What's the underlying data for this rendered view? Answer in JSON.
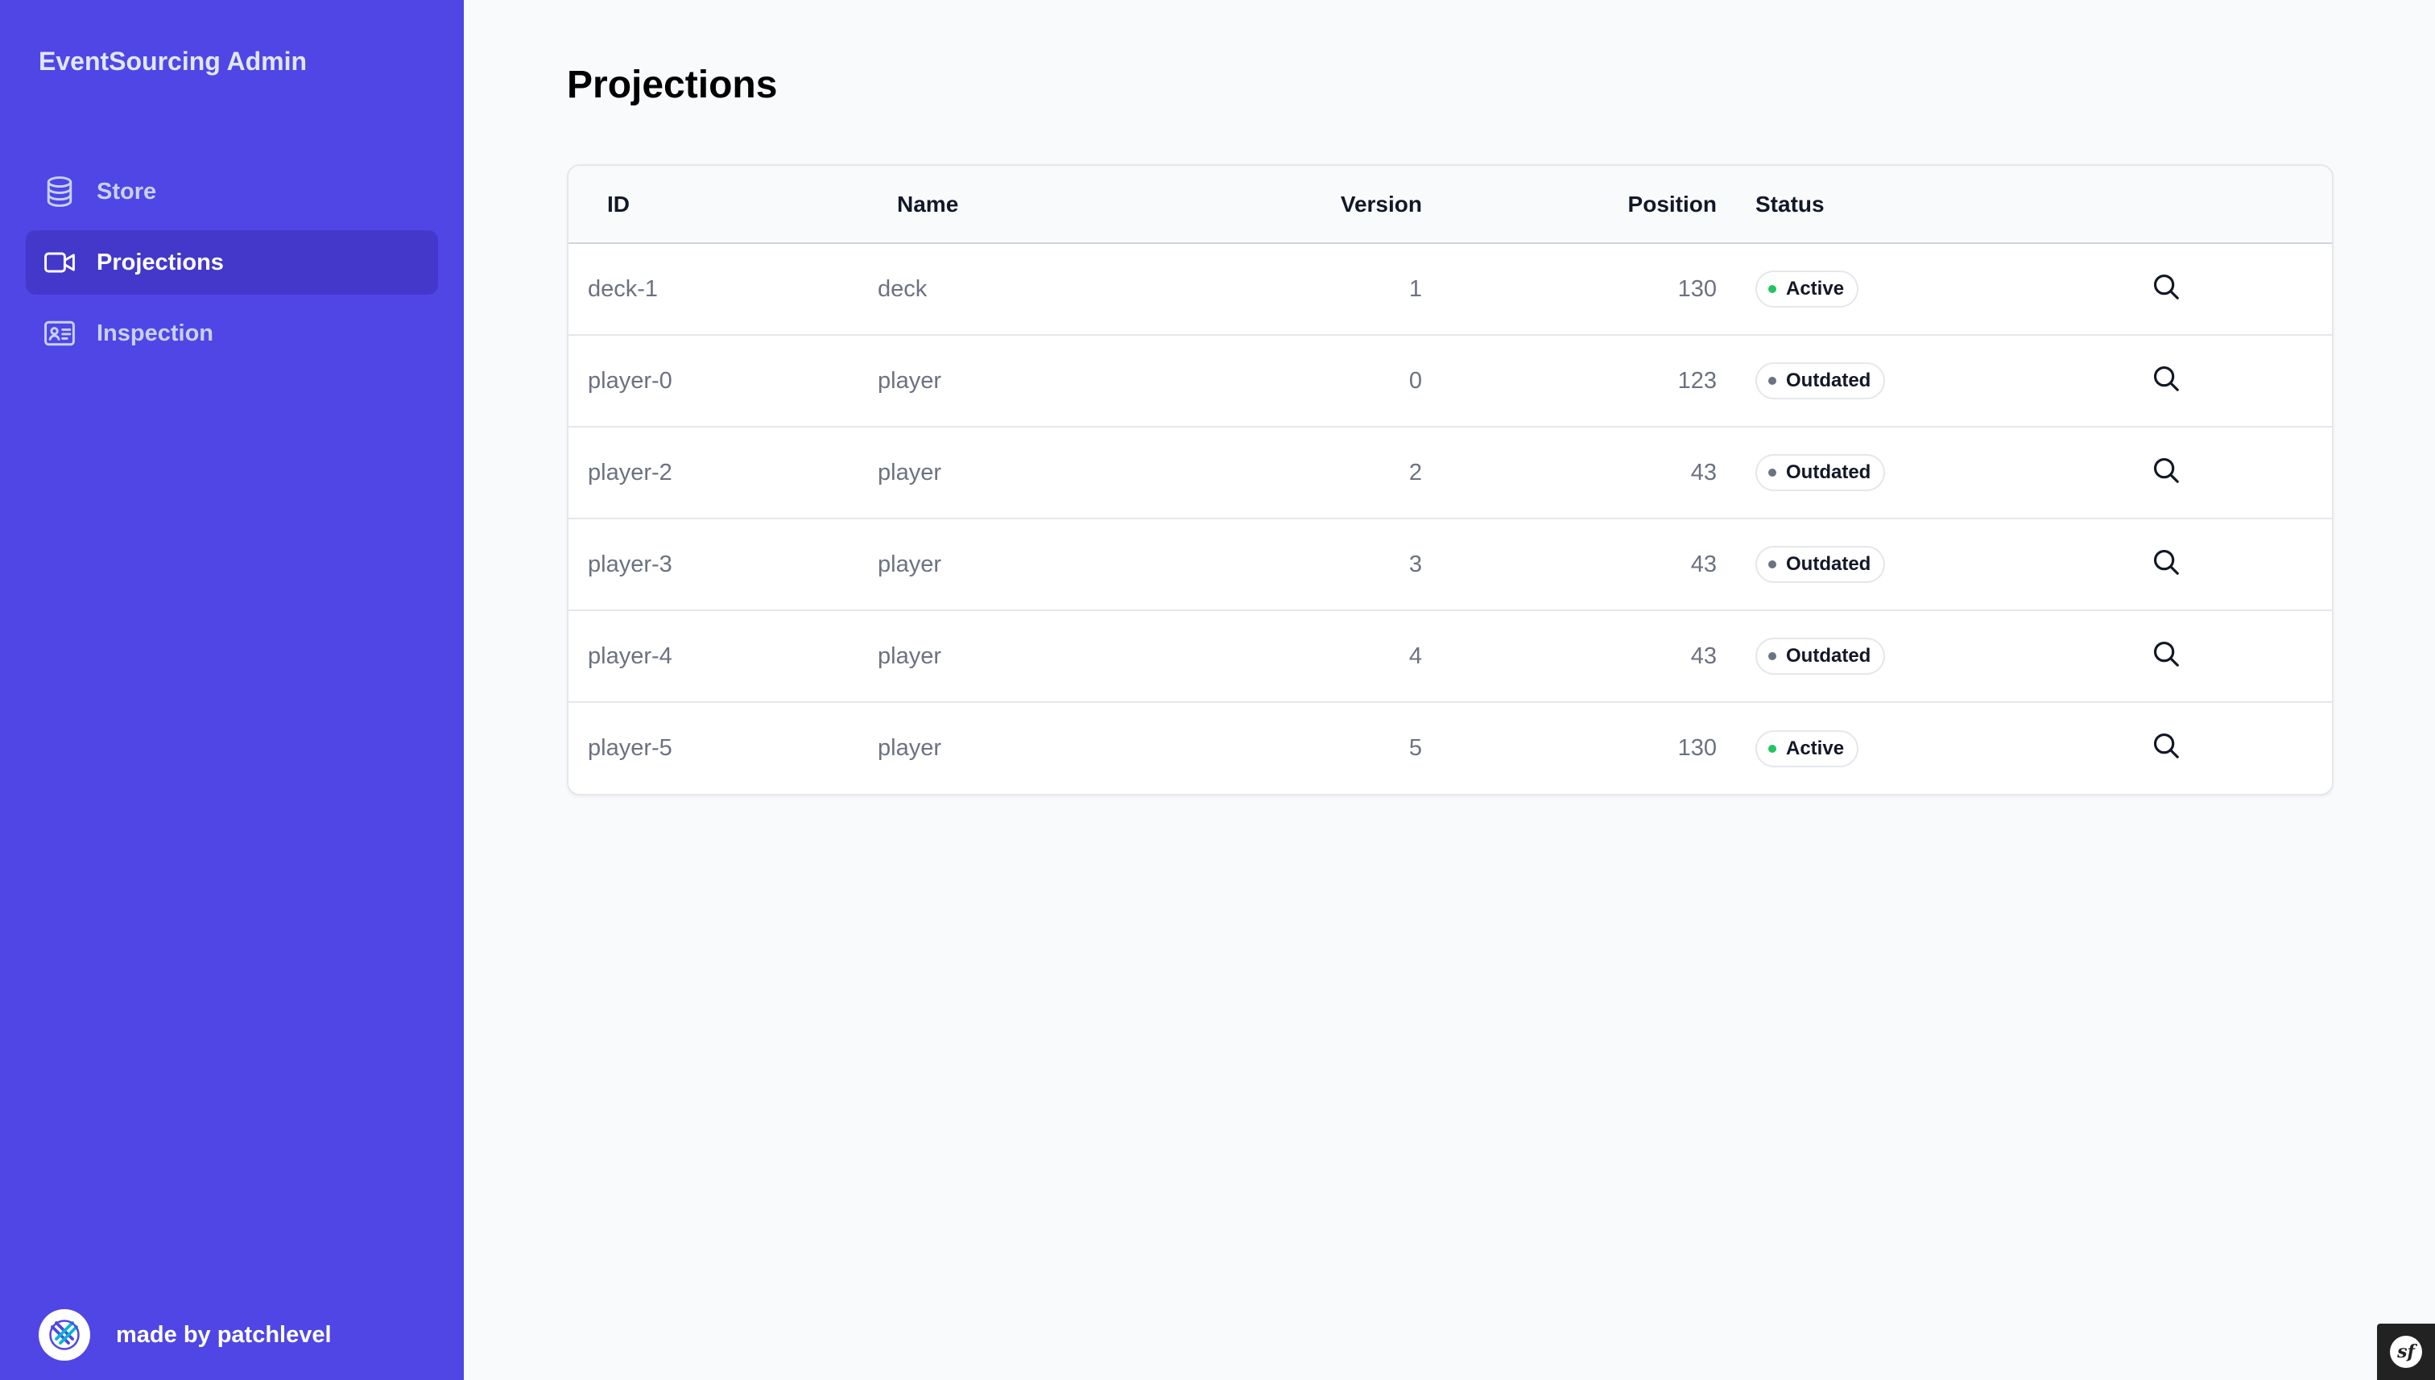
{
  "sidebar": {
    "brand": "EventSourcing Admin",
    "items": [
      {
        "label": "Store",
        "icon": "database-icon",
        "active": false
      },
      {
        "label": "Projections",
        "icon": "video-camera-icon",
        "active": true
      },
      {
        "label": "Inspection",
        "icon": "id-card-icon",
        "active": false
      }
    ],
    "footer": {
      "text": "made by patchlevel",
      "logo": "patchlevel-logo"
    }
  },
  "main": {
    "title": "Projections",
    "table": {
      "columns": [
        "ID",
        "Name",
        "Version",
        "Position",
        "Status"
      ],
      "rows": [
        {
          "id": "deck-1",
          "name": "deck",
          "version": "1",
          "position": "130",
          "status": "Active"
        },
        {
          "id": "player-0",
          "name": "player",
          "version": "0",
          "position": "123",
          "status": "Outdated"
        },
        {
          "id": "player-2",
          "name": "player",
          "version": "2",
          "position": "43",
          "status": "Outdated"
        },
        {
          "id": "player-3",
          "name": "player",
          "version": "3",
          "position": "43",
          "status": "Outdated"
        },
        {
          "id": "player-4",
          "name": "player",
          "version": "4",
          "position": "43",
          "status": "Outdated"
        },
        {
          "id": "player-5",
          "name": "player",
          "version": "5",
          "position": "130",
          "status": "Active"
        }
      ]
    }
  },
  "toolbar": {
    "logo": "sf"
  },
  "colors": {
    "sidebar": "#4f46e5",
    "sidebar_active": "#4338ca",
    "status_active": "#22c55e",
    "status_outdated": "#6b7280"
  }
}
